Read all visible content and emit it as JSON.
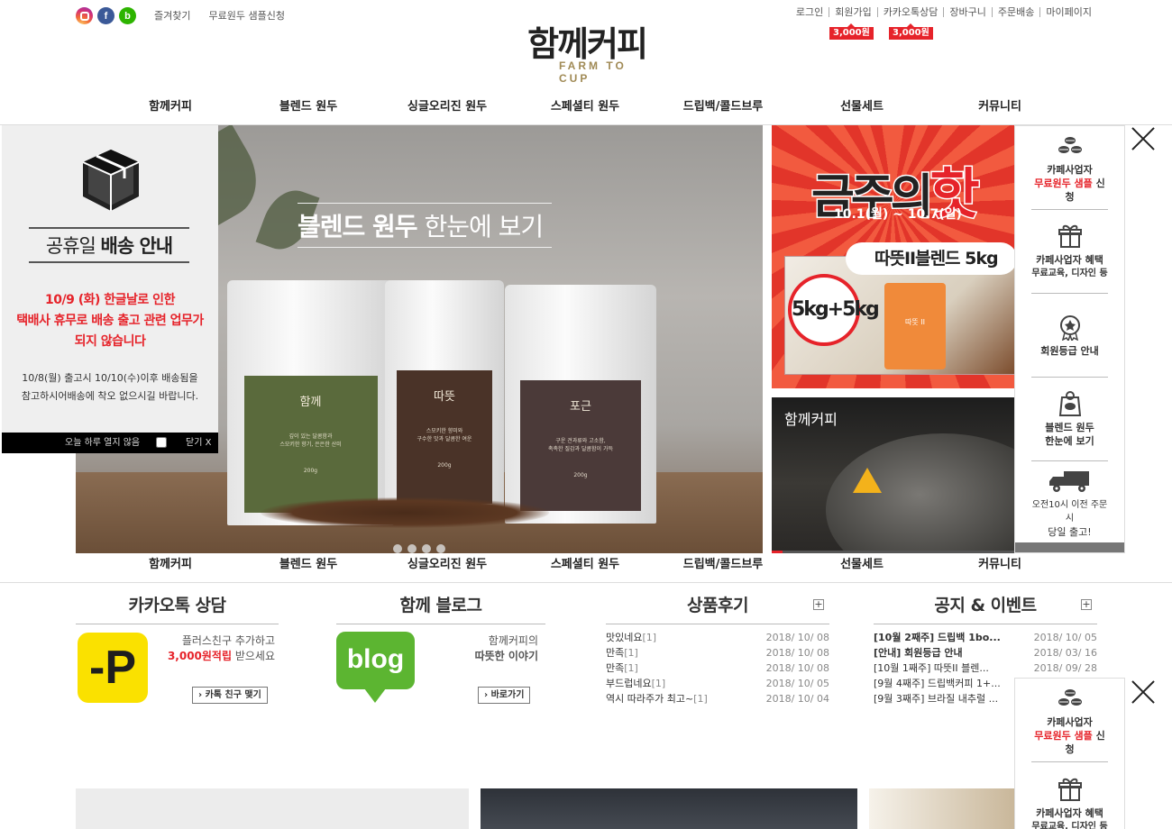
{
  "header": {
    "util_left": [
      "즐겨찾기",
      "무료원두 샘플신청"
    ],
    "util_right": [
      "로그인",
      "회원가입",
      "카카오톡상담",
      "장바구니",
      "주문배송",
      "마이페이지"
    ],
    "badges": [
      "3,000원",
      "3,000원"
    ],
    "logo_ko": "함께커피",
    "logo_en": "FARM TO CUP",
    "social": [
      "instagram-icon",
      "facebook-icon",
      "blog-b-icon"
    ]
  },
  "nav": [
    "함께커피",
    "블렌드 원두",
    "싱글오리진 원두",
    "스페셜티 원두",
    "드립백/콜드브루",
    "선물세트",
    "커뮤니티"
  ],
  "hero": {
    "title_bold": "블렌드 원두",
    "title_rest": " 한눈에 보기",
    "bags": [
      {
        "name": "함께",
        "desc1": "깊이 있는 달콤함과",
        "desc2": "스모키한 향기, 은은한 산미",
        "weight": "200g",
        "color": "#5a6a3c"
      },
      {
        "name": "따뜻",
        "desc1": "스모키한 향미와",
        "desc2": "구수한 맛과 달콤한 여운",
        "weight": "200g",
        "color": "#4a3328"
      },
      {
        "name": "포근",
        "desc1": "구운 견과류와 고소함,",
        "desc2": "촉촉한 질감과 달콤함이 가득",
        "weight": "200g",
        "color": "#4b3a39"
      }
    ],
    "slides": 4
  },
  "promo": {
    "title_a": "금주의",
    "title_b": "핫",
    "date": "10.1(월) ~ 10.7(일)",
    "product": "따뜻II블렌드 5kg",
    "offer": "5kg+5kg",
    "bag_label": "따뜻 II"
  },
  "video": {
    "title": "함께커피"
  },
  "quick_menu": [
    {
      "icon": "coffee-beans-icon",
      "line1": "카페사업자",
      "red": "무료원두 샘플",
      "line2": " 신청"
    },
    {
      "icon": "gift-icon",
      "line1": "카페사업자 혜택",
      "sub": "무료교육, 디자인 등"
    },
    {
      "icon": "medal-icon",
      "line1": "회원등급 안내"
    },
    {
      "icon": "bean-bag-icon",
      "line1": "블렌드 원두",
      "line2b": "한눈에 보기"
    },
    {
      "icon": "delivery-truck-icon",
      "sub_top": "오전10시 이전 주문시",
      "line1": "당일 출고!"
    }
  ],
  "popup": {
    "title_a": "공휴일 ",
    "title_b": "배송 안내",
    "red1": "10/9 (화) 한글날로 인한",
    "red2": "택배사 휴무로 배송 출고 관련 업무가",
    "red3": "되지 않습니다",
    "note1": "10/8(월) 출고시 10/10(수)이후 배송됨을",
    "note2": "참고하시어배송에 착오 없으시길 바랍니다.",
    "dont_show": "오늘 하루 열지 않음",
    "close": "닫기 X"
  },
  "kakao": {
    "title": "카카오톡 상담",
    "line1": "플러스친구 추가하고",
    "red": "3,000원적립",
    "rest": " 받으세요",
    "button": "카톡 친구 맺기"
  },
  "blog": {
    "title": "함께 블로그",
    "icon_text": "blog",
    "line1": "함께커피의",
    "line2": "따뜻한 이야기",
    "button": "바로가기"
  },
  "reviews": {
    "title": "상품후기",
    "items": [
      {
        "text": "맛있네요",
        "count": "[1]",
        "date": "2018/ 10/ 08"
      },
      {
        "text": "만족",
        "count": "[1]",
        "date": "2018/ 10/ 08"
      },
      {
        "text": "만족",
        "count": "[1]",
        "date": "2018/ 10/ 08"
      },
      {
        "text": "부드럽네요",
        "count": "[1]",
        "date": "2018/ 10/ 05"
      },
      {
        "text": "역시 따라주가 최고~",
        "count": "[1]",
        "date": "2018/ 10/ 04"
      }
    ]
  },
  "notices": {
    "title": "공지 & 이벤트",
    "items": [
      {
        "text": "[10월 2째주] 드립백 1bo...",
        "date": "2018/ 10/ 05",
        "bold": true
      },
      {
        "text": "[안내] 회원등급 안내",
        "date": "2018/ 03/ 16",
        "bold": true
      },
      {
        "text": "[10월 1째주] 따뜻II 블렌...",
        "date": "2018/ 09/ 28",
        "bold": false
      },
      {
        "text": "[9월 4째주] 드립백커피 1+...",
        "date": "",
        "bold": false
      },
      {
        "text": "[9월 3째주] 브라질 내추럴 ...",
        "date": "",
        "bold": false
      }
    ]
  }
}
